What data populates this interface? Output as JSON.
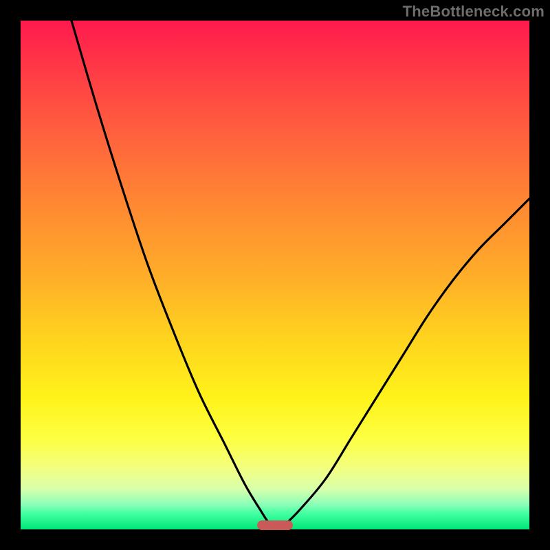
{
  "watermark": "TheBottleneck.com",
  "chart_data": {
    "type": "line",
    "title": "",
    "xlabel": "",
    "ylabel": "",
    "xlim": [
      0,
      100
    ],
    "ylim": [
      0,
      100
    ],
    "grid": false,
    "legend": false,
    "marker": {
      "x": 50,
      "width": 7,
      "color": "#c85a5a"
    },
    "background_gradient": {
      "top": "#ff1a4d",
      "bottom": "#00e676",
      "meaning": "red=high, green=low"
    },
    "series": [
      {
        "name": "left-curve",
        "x": [
          10,
          15,
          20,
          25,
          30,
          35,
          40,
          44,
          47,
          49,
          50.5
        ],
        "values": [
          100,
          83,
          67,
          52,
          39,
          27,
          17,
          9,
          4,
          1,
          0
        ]
      },
      {
        "name": "right-curve",
        "x": [
          50.5,
          52,
          55,
          60,
          65,
          70,
          75,
          80,
          85,
          90,
          95,
          100
        ],
        "values": [
          0,
          1,
          4,
          10,
          18,
          26,
          34,
          42,
          49,
          55,
          60,
          65
        ]
      }
    ]
  }
}
